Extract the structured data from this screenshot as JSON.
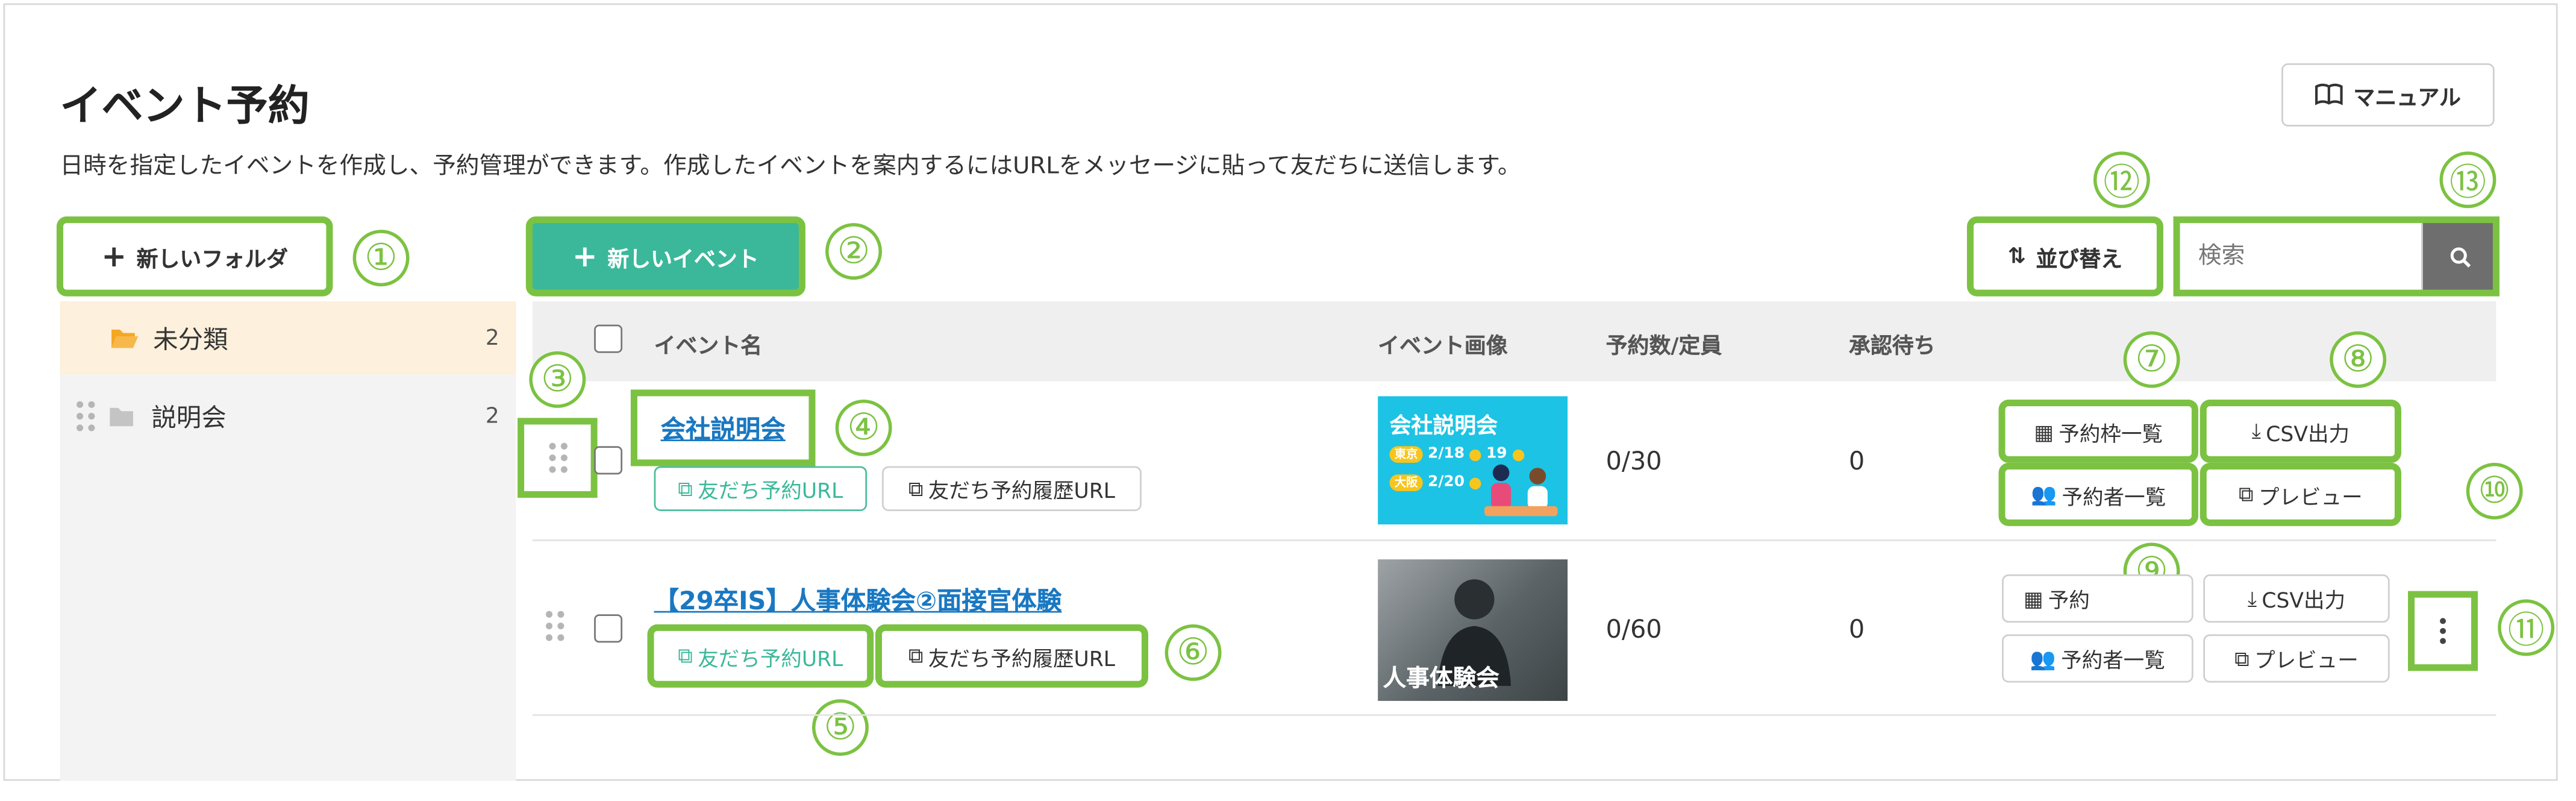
{
  "page": {
    "title": "イベント予約",
    "description": "日時を指定したイベントを作成し、予約管理ができます。作成したイベントを案内するにはURLをメッセージに貼って友だちに送信します。",
    "manual_label": "マニュアル",
    "new_folder_label": "新しいフォルダ",
    "new_event_label": "新しいイベント",
    "sort_label": "並び替え",
    "search_placeholder": "検索"
  },
  "sidebar": {
    "folders": [
      {
        "name": "未分類",
        "count": "2",
        "selected": true
      },
      {
        "name": "説明会",
        "count": "2",
        "selected": false
      }
    ]
  },
  "table": {
    "headers": [
      "イベント名",
      "イベント画像",
      "予約数/定員",
      "承認待ち"
    ],
    "rows": [
      {
        "name": "会社説明会",
        "friend_url": "友だち予約URL",
        "history_url": "友だち予約履歴URL",
        "image_title": "会社説明会",
        "image_tag1": "東京",
        "image_dates1": "2/18",
        "image_dates1b": "19",
        "image_tag2": "大阪",
        "image_dates2": "2/20",
        "capacity": "0/30",
        "pending": "0",
        "slots_btn": "予約枠一覧",
        "csv_btn": "CSV出力",
        "reservers_btn": "予約者一覧",
        "preview_btn": "プレビュー"
      },
      {
        "name": "【29卒IS】人事体験会②面接官体験",
        "friend_url": "友だち予約URL",
        "history_url": "友だち予約履歴URL",
        "image_title": "人事体験会",
        "capacity": "0/60",
        "pending": "0",
        "slots_btn": "予約",
        "csv_btn": "CSV出力",
        "reservers_btn": "予約者一覧",
        "preview_btn": "プレビュー"
      }
    ]
  },
  "markers": [
    "①",
    "②",
    "③",
    "④",
    "⑤",
    "⑥",
    "⑦",
    "⑧",
    "⑨",
    "⑩",
    "⑪",
    "⑫",
    "⑬"
  ],
  "colors": {
    "accent": "#3bb89a",
    "link": "#1a78c2",
    "annotation": "#7cc242",
    "selected_folder_bg": "#fdf0dc",
    "folder_icon": "#f5a623"
  }
}
